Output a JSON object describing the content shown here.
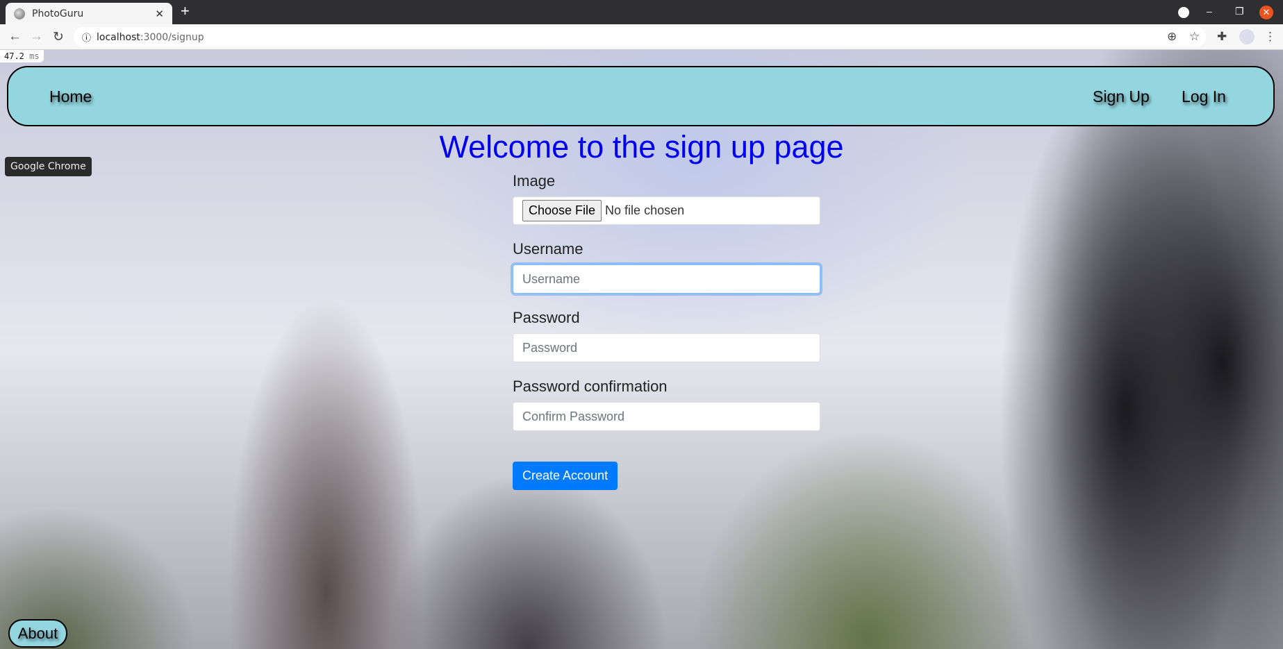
{
  "browser": {
    "tab_title": "PhotoGuru",
    "url_host": "localhost",
    "url_path": ":3000/signup",
    "tooltip": "Google Chrome",
    "perf_value": "47.2",
    "perf_unit": "ms"
  },
  "navbar": {
    "home": "Home",
    "signup": "Sign Up",
    "login": "Log In"
  },
  "page": {
    "title": "Welcome to the sign up page"
  },
  "form": {
    "image_label": "Image",
    "choose_file": "Choose File",
    "no_file": "No file chosen",
    "username_label": "Username",
    "username_placeholder": "Username",
    "password_label": "Password",
    "password_placeholder": "Password",
    "confirm_label": "Password confirmation",
    "confirm_placeholder": "Confirm Password",
    "submit": "Create Account"
  },
  "footer": {
    "about": "About"
  },
  "colors": {
    "navbar": "#94d6e0",
    "title": "#0000ee",
    "primary": "#007bff"
  }
}
